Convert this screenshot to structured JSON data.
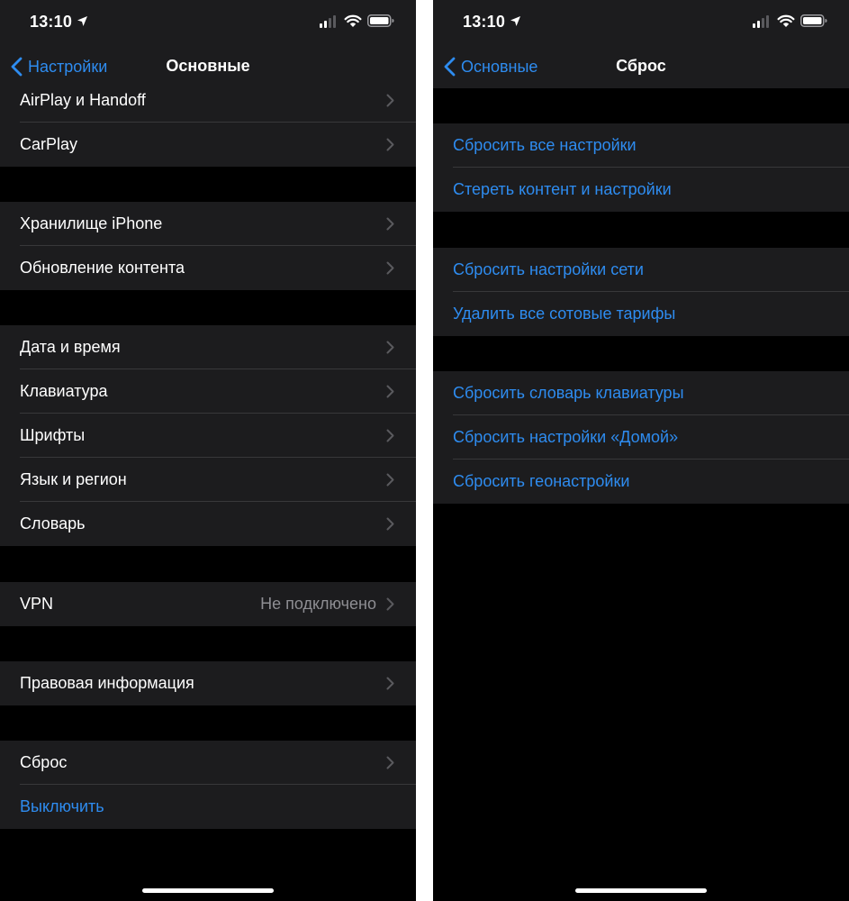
{
  "left": {
    "status": {
      "time": "13:10"
    },
    "nav": {
      "back_label": "Настройки",
      "title": "Основные"
    },
    "section1": [
      {
        "label": "AirPlay и Handoff"
      },
      {
        "label": "CarPlay"
      }
    ],
    "section2": [
      {
        "label": "Хранилище iPhone"
      },
      {
        "label": "Обновление контента"
      }
    ],
    "section3": [
      {
        "label": "Дата и время"
      },
      {
        "label": "Клавиатура"
      },
      {
        "label": "Шрифты"
      },
      {
        "label": "Язык и регион"
      },
      {
        "label": "Словарь"
      }
    ],
    "section4": [
      {
        "label": "VPN",
        "value": "Не подключено"
      }
    ],
    "section5": [
      {
        "label": "Правовая информация"
      }
    ],
    "section6": [
      {
        "label": "Сброс"
      },
      {
        "label": "Выключить"
      }
    ]
  },
  "right": {
    "status": {
      "time": "13:10"
    },
    "nav": {
      "back_label": "Основные",
      "title": "Сброс"
    },
    "section1": [
      {
        "label": "Сбросить все настройки"
      },
      {
        "label": "Стереть контент и настройки"
      }
    ],
    "section2": [
      {
        "label": "Сбросить настройки сети"
      },
      {
        "label": "Удалить все сотовые тарифы"
      }
    ],
    "section3": [
      {
        "label": "Сбросить словарь клавиатуры"
      },
      {
        "label": "Сбросить настройки «Домой»"
      },
      {
        "label": "Сбросить геонастройки"
      }
    ]
  },
  "theme": {
    "background": "#000000",
    "cell": "#1c1c1e",
    "accent": "#2e8cf0",
    "separator": "#38383a",
    "secondary_text": "#8e8e93"
  },
  "icons": {
    "status": [
      "location-arrow-icon",
      "cellular-signal-icon",
      "wifi-icon",
      "battery-icon"
    ],
    "row": "chevron-right-icon",
    "back": "chevron-left-icon"
  }
}
